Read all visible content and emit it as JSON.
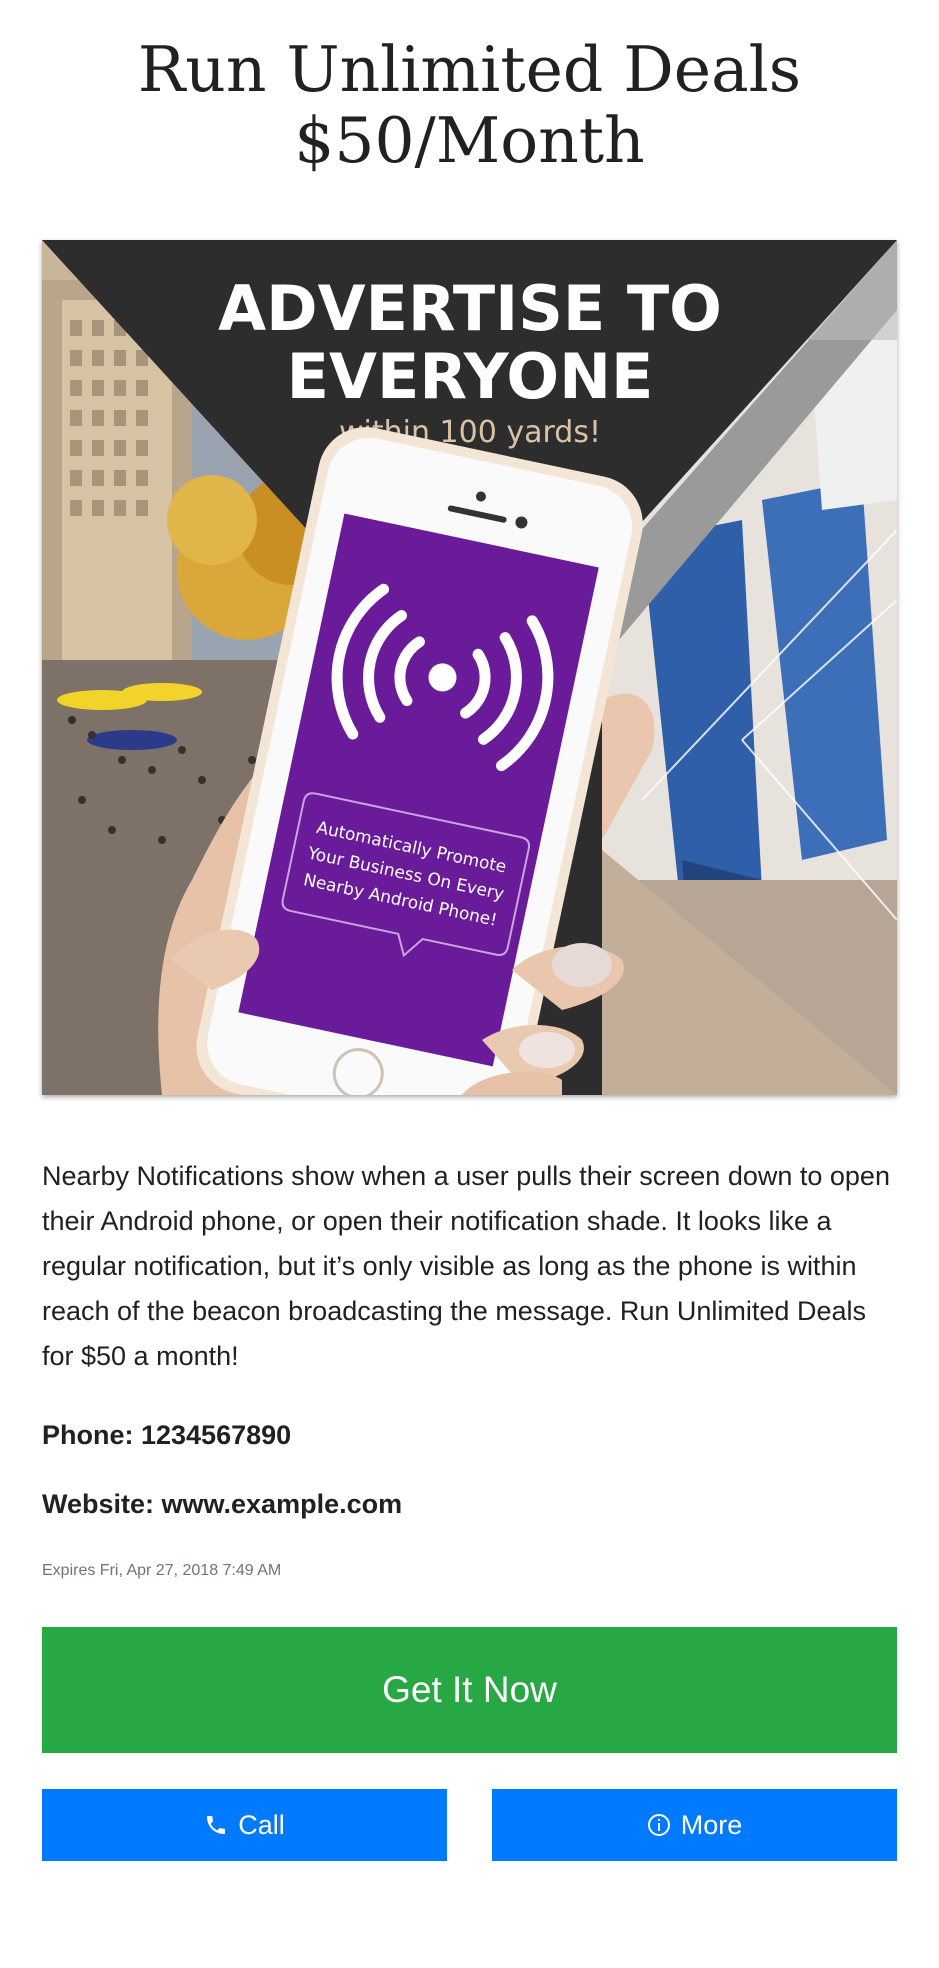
{
  "header": {
    "title_line1": "Run Unlimited Deals",
    "title_line2": "$50/Month"
  },
  "hero": {
    "headline_line1": "ADVERTISE TO",
    "headline_line2": "EVERYONE",
    "subheadline": "within 100 yards!",
    "bubble_line1": "Automatically Promote",
    "bubble_line2": "Your Business On Every",
    "bubble_line3": "Nearby Android Phone!",
    "icon": "broadcast-signal-icon"
  },
  "description": "Nearby Notifications show when a user pulls their screen down to open their Android phone, or open their notification shade. It looks like a regular notification, but it’s only visible as long as the phone is within reach of the beacon broadcasting the message. Run Unlimited Deals for $50 a month!",
  "contact": {
    "phone": "Phone: 1234567890",
    "website": "Website: www.example.com"
  },
  "expires": "Expires Fri, Apr 27, 2018 7:49 AM",
  "buttons": {
    "primary_label": "Get It Now",
    "call_label": "Call",
    "call_icon": "phone-icon",
    "more_label": "More",
    "more_icon": "info-icon"
  },
  "colors": {
    "primary": "#28a745",
    "secondary": "#007bff",
    "phone_screen": "#6a1b9a",
    "hero_banner": "#2d2d2d"
  }
}
